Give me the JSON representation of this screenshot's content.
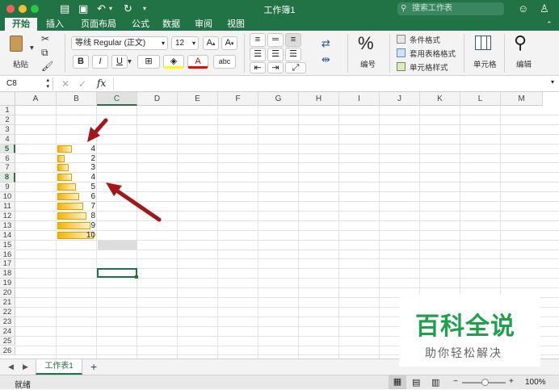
{
  "window": {
    "title": "工作簿1",
    "search_placeholder": "搜索工作表"
  },
  "tabs": [
    "开始",
    "插入",
    "页面布局",
    "公式",
    "数据",
    "审阅",
    "视图"
  ],
  "ribbon": {
    "paste_label": "粘贴",
    "font_name": "等线 Regular (正文)",
    "font_size": "12",
    "number_label": "编号",
    "conditional_format": "条件格式",
    "table_format": "套用表格格式",
    "cell_styles": "单元格样式",
    "cells_label": "单元格",
    "edit_label": "编辑"
  },
  "formula_bar": {
    "name_box": "C8",
    "fx": "fx",
    "value": ""
  },
  "grid": {
    "columns": [
      "A",
      "B",
      "C",
      "D",
      "E",
      "F",
      "G",
      "H",
      "I",
      "J",
      "K",
      "L",
      "M"
    ],
    "rows": [
      "1",
      "2",
      "3",
      "4",
      "5",
      "6",
      "7",
      "8",
      "9",
      "10",
      "11",
      "12",
      "13",
      "14",
      "15",
      "16",
      "17",
      "18",
      "19",
      "20",
      "21",
      "22",
      "23",
      "24",
      "25",
      "26"
    ],
    "selected_cell": "C8",
    "data_bar_values": [
      4,
      2,
      3,
      4,
      5,
      6,
      7,
      8,
      9,
      10
    ],
    "data_bar_max": 10
  },
  "sheet_tabs": [
    "工作表1"
  ],
  "status": {
    "ready": "就绪",
    "zoom": "100%"
  },
  "watermark": {
    "title": "百科全说",
    "subtitle": "助你轻松解决"
  },
  "colors": {
    "brand": "#217346",
    "bar": "#f5b400",
    "arrow": "#a3161a"
  }
}
